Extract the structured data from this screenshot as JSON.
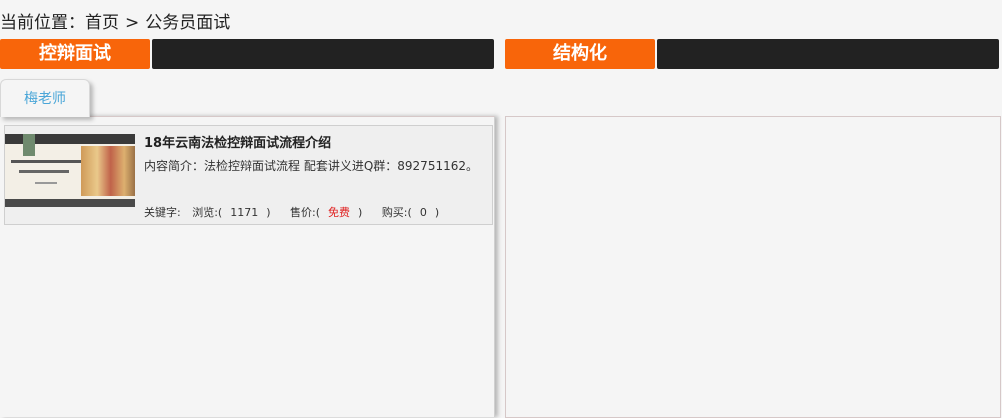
{
  "breadcrumb": {
    "prefix": "当前位置：",
    "home": "首页",
    "separator": ">",
    "current": "公务员面试"
  },
  "columns": {
    "left": {
      "title": "控辩面试"
    },
    "right": {
      "title": "结构化"
    }
  },
  "teacher_tab": {
    "label": "梅老师"
  },
  "course": {
    "title": "18年云南法检控辩面试流程介绍",
    "desc_label": "内容简介：",
    "desc": "法检控辩面试流程 配套讲义进Q群：892751162。",
    "keyword_label": "关键字:",
    "views_label": "浏览:(",
    "views": "1171",
    "views_close": ")",
    "price_label": "售价:(",
    "price": "免费",
    "price_close": ")",
    "buy_label": "购买:(",
    "buys": "0",
    "buy_close": ")"
  },
  "colors": {
    "accent": "#f8650a",
    "header_bar": "#222222",
    "tab_text": "#4aa6d8",
    "price_free": "#e02020"
  }
}
